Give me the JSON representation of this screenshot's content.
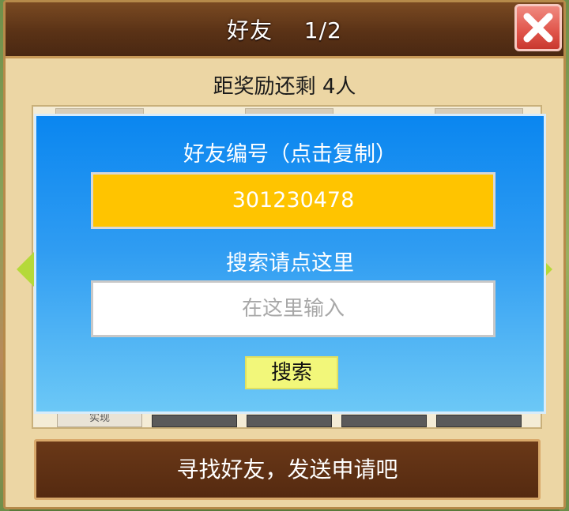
{
  "header": {
    "title": "好友",
    "page_indicator": "1/2",
    "close_icon": "close-x-icon"
  },
  "subtitle": "距奖励还剩 4人",
  "grid": {
    "partial_slot_label": "实现"
  },
  "dialog": {
    "friend_id_label": "好友编号（点击复制）",
    "friend_id_value": "301230478",
    "search_label": "搜索请点这里",
    "search_placeholder": "在这里输入",
    "search_button": "搜索"
  },
  "footer": {
    "button_label": "寻找好友，发送申请吧"
  },
  "colors": {
    "header_brown": "#5a3216",
    "panel_beige": "#ecd6a4",
    "dialog_blue": "#0a86f0",
    "id_yellow": "#ffc400",
    "search_button_yellow": "#f2f77a",
    "close_red": "#e0544a",
    "arrow_green": "#b5d93a"
  }
}
